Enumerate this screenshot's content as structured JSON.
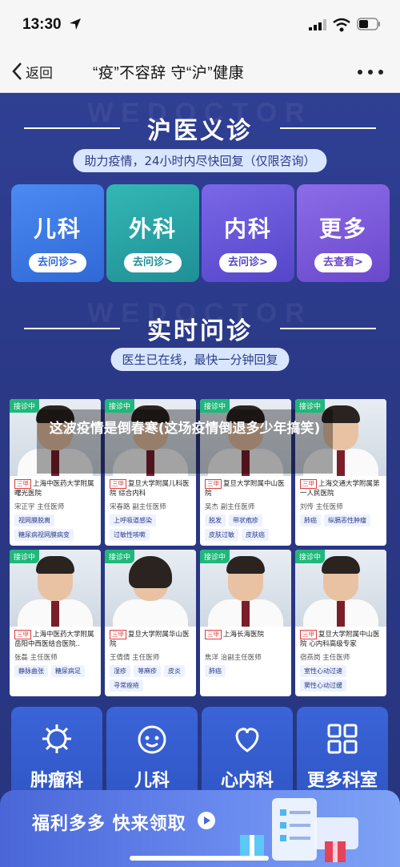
{
  "status": {
    "time": "13:30"
  },
  "nav": {
    "back_label": "返回",
    "title": "“疫”不容辞 守“沪”健康"
  },
  "hero": {
    "watermark": "WEDOCTOR",
    "title": "沪医义诊",
    "subtitle": "助力疫情，24小时内尽快回复（仅限咨询）"
  },
  "departments": [
    {
      "name": "儿科",
      "button": "去问诊>",
      "color": "#3f7ee8"
    },
    {
      "name": "外科",
      "button": "去问诊>",
      "color": "#29a6a6"
    },
    {
      "name": "内科",
      "button": "去问诊>",
      "color": "#6a5ad8"
    },
    {
      "name": "更多",
      "button": "去查看>",
      "color": "#7c59d8"
    }
  ],
  "live": {
    "watermark": "WEDOCTOR",
    "title": "实时问诊",
    "subtitle": "医生已在线，最快一分钟回复"
  },
  "live_badge": "接诊中",
  "grade_tag": "三甲",
  "doctors": [
    {
      "hospital": "上海中医药大学附属曙光医院",
      "name": "宋正宇  主任医师",
      "chips": [
        "视网膜脱离",
        "糖尿病视网膜病变"
      ]
    },
    {
      "hospital": "复旦大学附属儿科医院 综合内科",
      "name": "宋春路  副主任医师",
      "chips": [
        "上呼吸道感染",
        "过敏性咳嗽"
      ]
    },
    {
      "hospital": "复旦大学附属中山医院",
      "name": "吴杰  副主任医师",
      "chips": [
        "脱发",
        "带状疱疹",
        "皮肤过敏",
        "皮肤癌"
      ]
    },
    {
      "hospital": "上海交通大学附属第一人民医院",
      "name": "刘传  主任医师",
      "chips": [
        "肺癌",
        "纵膈恶性肿瘤"
      ]
    },
    {
      "hospital": "上海中医药大学附属岳阳中西医结合医院..",
      "name": "张磊  主任医师",
      "chips": [
        "静脉曲张",
        "糖尿病足"
      ]
    },
    {
      "hospital": "复旦大学附属华山医院",
      "name": "王倩倩  主任医师",
      "chips": [
        "湿疹",
        "荨麻疹",
        "皮炎",
        "寻常痤疮"
      ]
    },
    {
      "hospital": "上海长海医院",
      "name": "焦洋  治副主任医师",
      "chips": [
        "肺癌"
      ]
    },
    {
      "hospital": "复旦大学附属中山医院 心内科高级专家",
      "name": "宿燕岗  主任医师",
      "chips": [
        "室性心动过速",
        "窦性心动过缓"
      ]
    }
  ],
  "overlay_caption": "这波疫情是倒春寒(这场疫情倒退多少年搞笑)",
  "categories": [
    {
      "name": "肿瘤科",
      "icon": "virus-icon"
    },
    {
      "name": "儿科",
      "icon": "smiley-face-icon"
    },
    {
      "name": "心内科",
      "icon": "heart-icon"
    },
    {
      "name": "更多科室",
      "icon": "grid-icon"
    }
  ],
  "promo": {
    "text": "福利多多 快来领取"
  }
}
